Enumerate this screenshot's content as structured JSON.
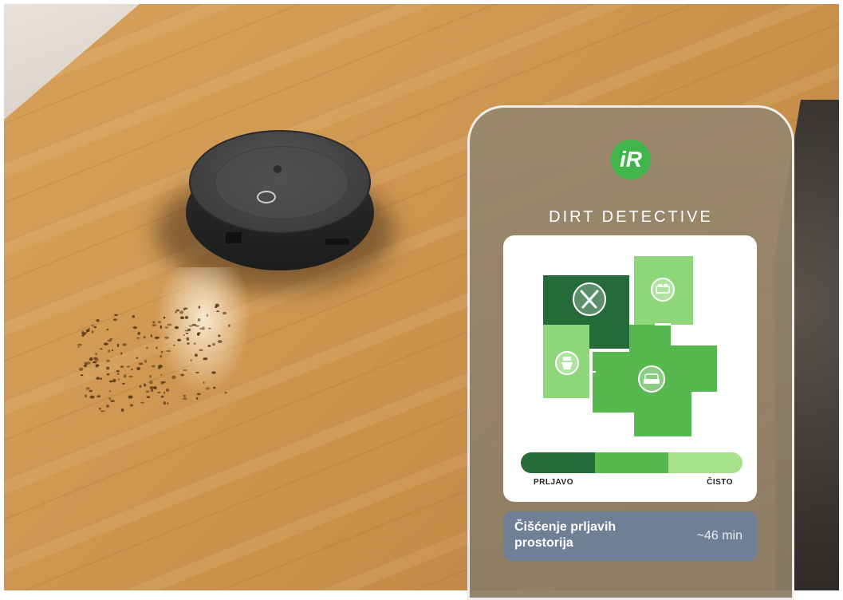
{
  "app": {
    "logo_text": "iR",
    "title": "DIRT DETECTIVE"
  },
  "map": {
    "rooms": [
      {
        "name": "kitchen",
        "icon": "utensils-icon",
        "level": "dirty",
        "color": "#256b3a"
      },
      {
        "name": "bedroom",
        "icon": "bed-icon",
        "level": "clean",
        "color": "#8fd67a"
      },
      {
        "name": "bathroom",
        "icon": "toilet-icon",
        "level": "clean",
        "color": "#8fd67a"
      },
      {
        "name": "living-room",
        "icon": "armchair-icon",
        "level": "medium",
        "color": "#56b84e"
      }
    ]
  },
  "legend": {
    "dirty_label": "PRLJAVO",
    "clean_label": "ČISTO",
    "colors": [
      "#256b3a",
      "#56b84e",
      "#a6e28c"
    ]
  },
  "status": {
    "text": "Čišćenje prljavih prostorija",
    "time": "~46 min"
  },
  "colors": {
    "brand_green": "#3fb54a",
    "status_card": "#6f7f96"
  }
}
